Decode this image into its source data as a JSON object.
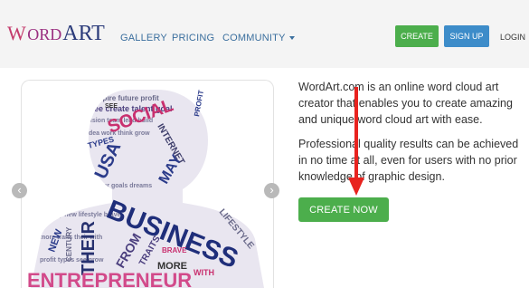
{
  "nav": {
    "logo": {
      "part1": "W",
      "part2": "ORD",
      "part3": "ART"
    },
    "links": [
      {
        "label": "GALLERY"
      },
      {
        "label": "PRICING"
      },
      {
        "label": "COMMUNITY"
      }
    ],
    "create_label": "CREATE",
    "signup_label": "SIGN UP",
    "login_label": "LOGIN"
  },
  "showcase": {
    "prev_symbol": "‹",
    "next_symbol": "›",
    "cloud_words": [
      "SOCIAL",
      "USA",
      "INTERNET",
      "MAY",
      "BUSINESS",
      "THEIR",
      "FROM",
      "TRAITS",
      "MORE",
      "ENTREPRENEUR",
      "LIFESTYLE",
      "PROFIT",
      "TYPES",
      "BRAVE",
      "NEW",
      "CENTURY",
      "SEE",
      "WITH"
    ]
  },
  "main": {
    "paragraph1": "WordArt.com is an online word cloud art creator that enables you to create amazing and unique word cloud art with ease.",
    "paragraph2": "Professional quality results can be achieved in no time at all, even for users with no prior knowledge of graphic design.",
    "create_now_label": "CREATE NOW"
  },
  "colors": {
    "green": "#4cae4c",
    "blue": "#3d8cc9",
    "link": "#3b6f9e",
    "annotation_arrow": "#e8231f"
  }
}
